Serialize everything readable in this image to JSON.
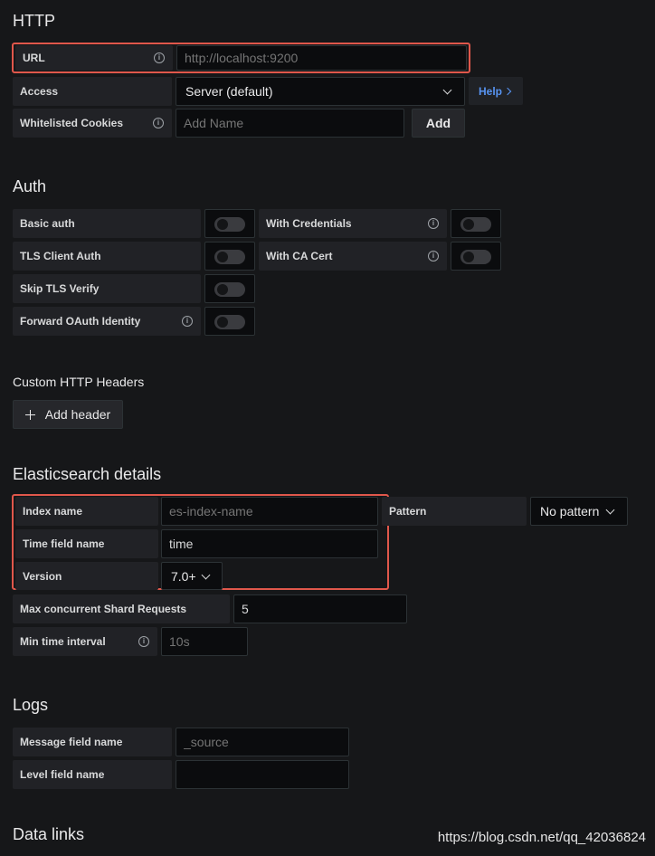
{
  "http": {
    "heading": "HTTP",
    "url_label": "URL",
    "url_placeholder": "http://localhost:9200",
    "access_label": "Access",
    "access_value": "Server (default)",
    "help_label": "Help",
    "cookies_label": "Whitelisted Cookies",
    "cookies_placeholder": "Add Name",
    "add_label": "Add"
  },
  "auth": {
    "heading": "Auth",
    "basic_auth": "Basic auth",
    "with_credentials": "With Credentials",
    "tls_client_auth": "TLS Client Auth",
    "with_ca_cert": "With CA Cert",
    "skip_tls_verify": "Skip TLS Verify",
    "forward_oauth": "Forward OAuth Identity"
  },
  "headers": {
    "heading": "Custom HTTP Headers",
    "add_header_label": "Add header"
  },
  "es": {
    "heading": "Elasticsearch details",
    "index_label": "Index name",
    "index_placeholder": "es-index-name",
    "pattern_label": "Pattern",
    "pattern_value": "No pattern",
    "time_field_label": "Time field name",
    "time_field_value": "time",
    "version_label": "Version",
    "version_value": "7.0+",
    "shard_label": "Max concurrent Shard Requests",
    "shard_value": "5",
    "interval_label": "Min time interval",
    "interval_placeholder": "10s"
  },
  "logs": {
    "heading": "Logs",
    "message_label": "Message field name",
    "message_placeholder": "_source",
    "level_label": "Level field name",
    "level_value": ""
  },
  "data_links": {
    "heading": "Data links"
  },
  "watermark": "https://blog.csdn.net/qq_42036824",
  "colors": {
    "background": "#161719",
    "highlight": "#e0574b",
    "link": "#5794f2"
  }
}
